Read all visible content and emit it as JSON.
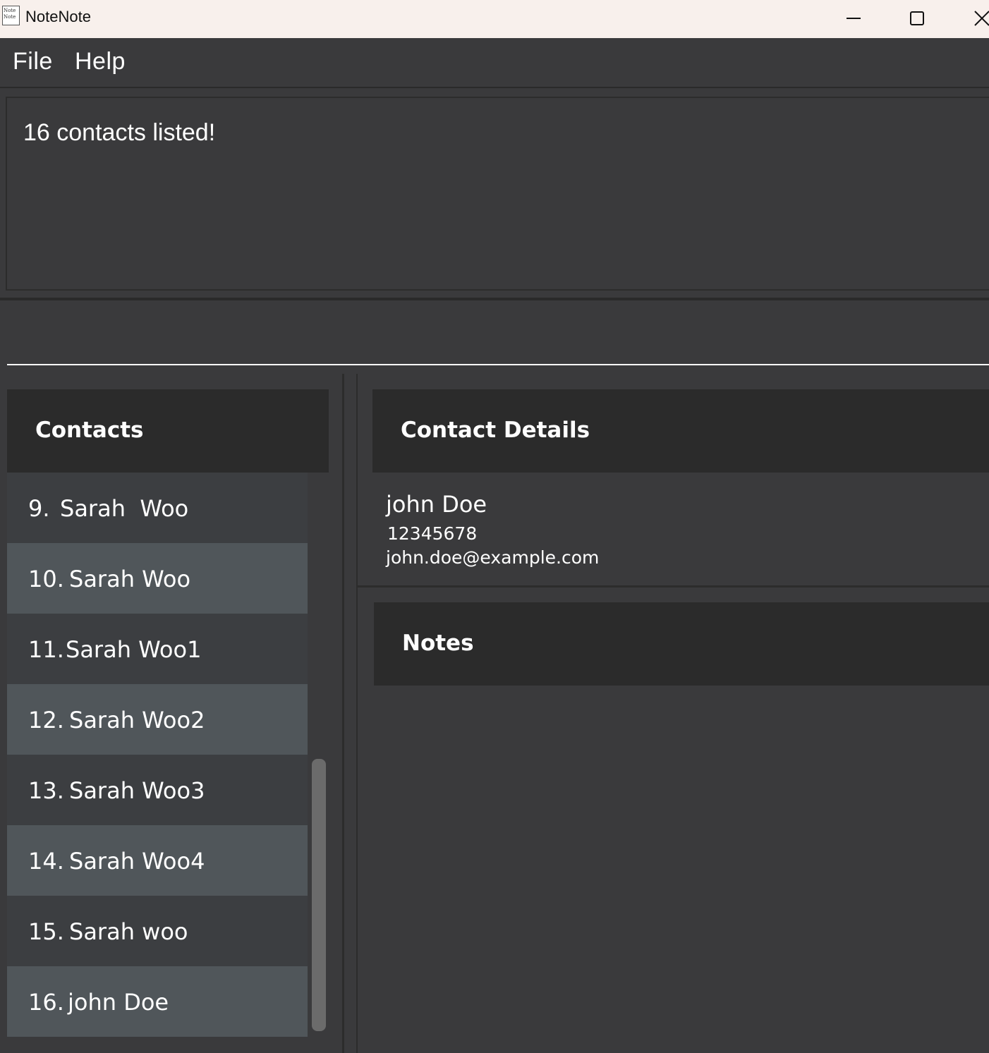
{
  "window": {
    "title": "NoteNote",
    "icon_text": "Note Note",
    "controls": [
      "minimize-icon",
      "maximize-icon",
      "close-icon"
    ]
  },
  "menu": {
    "file": "File",
    "help": "Help"
  },
  "result": {
    "message": "16 contacts listed!"
  },
  "command": {
    "value": ""
  },
  "contacts_panel": {
    "title": "Contacts",
    "items": [
      {
        "index": "9.",
        "name": "Sarah  Woo"
      },
      {
        "index": "10.",
        "name": "Sarah Woo"
      },
      {
        "index": "11.",
        "name": "Sarah Woo1"
      },
      {
        "index": "12.",
        "name": "Sarah Woo2"
      },
      {
        "index": "13.",
        "name": "Sarah Woo3"
      },
      {
        "index": "14.",
        "name": "Sarah Woo4"
      },
      {
        "index": "15.",
        "name": "Sarah woo"
      },
      {
        "index": "16.",
        "name": "john Doe"
      }
    ]
  },
  "details_panel": {
    "title": "Contact Details",
    "name": "john Doe",
    "phone": "12345678",
    "email": "john.doe@example.com"
  },
  "notes_panel": {
    "title": "Notes"
  },
  "colors": {
    "background": "#3a3a3c",
    "header": "#2b2b2b",
    "row_odd": "#3c3e41",
    "row_even": "#50565a",
    "titlebar": "#f8f0ec"
  }
}
